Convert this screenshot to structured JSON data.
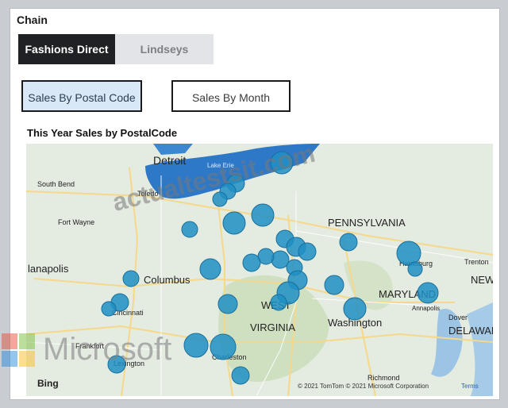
{
  "chain": {
    "title": "Chain",
    "options": [
      "Fashions Direct",
      "Lindseys"
    ],
    "selected": "Fashions Direct"
  },
  "tabs": {
    "postal": "Sales By Postal Code",
    "month": "Sales By Month"
  },
  "map": {
    "title": "This Year Sales by PostalCode",
    "places": {
      "detroit": "Detroit",
      "lake_erie": "Lake Erie",
      "south_bend": "South Bend",
      "toledo": "Toledo",
      "fort_wayne": "Fort Wayne",
      "pennsylvania": "PENNSYLVANIA",
      "indianapolis": "lanapolis",
      "columbus": "Columbus",
      "harrisburg": "Harrisburg",
      "trenton": "Trenton",
      "new": "NEW",
      "cincinnati": "Cincinnati",
      "maryland": "MARYLAND",
      "annapolis": "Annapolis",
      "west": "WEST",
      "virginia": "VIRGINIA",
      "washington": "Washington",
      "dover": "Dover",
      "delaware": "DELAWAR",
      "frankfort": "Frankfort",
      "lexington": "Lexington",
      "charleston": "Charleston",
      "richmond": "Richmond"
    },
    "attribution": "© 2021 TomTom © 2021 Microsoft Corporation",
    "terms": "Terms",
    "provider": "Bing",
    "bubble_color": "#1f8fc4"
  },
  "watermarks": {
    "site": "actualtestsit.com",
    "brand": "Microsoft"
  }
}
